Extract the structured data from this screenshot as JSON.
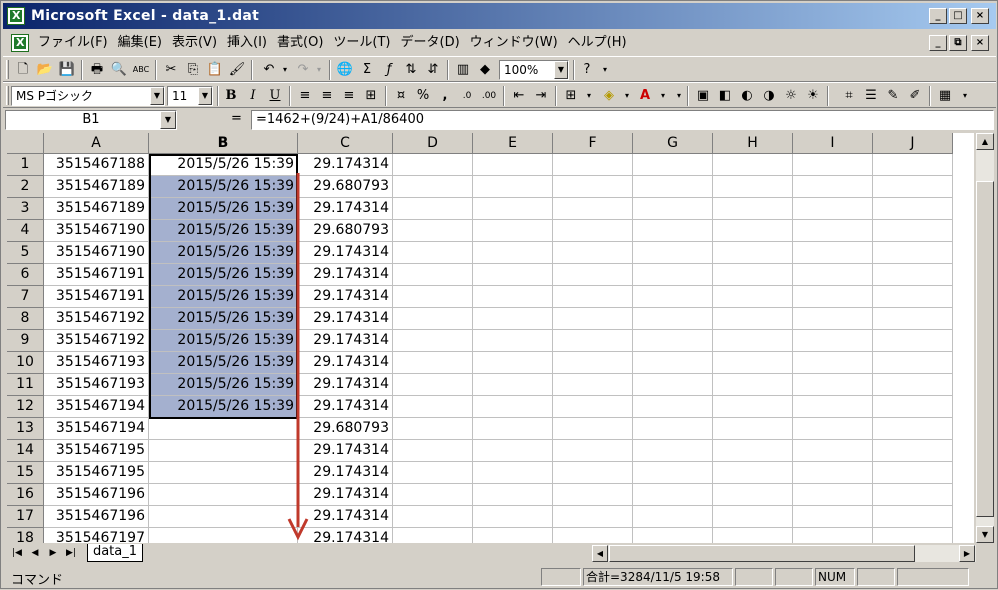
{
  "window": {
    "title": "Microsoft Excel - data_1.dat"
  },
  "title_buttons": {
    "minimize": "_",
    "restore": "□",
    "close": "×"
  },
  "doc_buttons": {
    "minimize": "_",
    "restore": "⧉",
    "close": "×"
  },
  "menu": [
    "ファイル(F)",
    "編集(E)",
    "表示(V)",
    "挿入(I)",
    "書式(O)",
    "ツール(T)",
    "データ(D)",
    "ウィンドウ(W)",
    "ヘルプ(H)"
  ],
  "toolbar": {
    "zoom": "100%"
  },
  "format_toolbar": {
    "font": "MS Pゴシック",
    "size": "11"
  },
  "formula_bar": {
    "name_box": "B1",
    "equals": "=",
    "formula": "=1462+(9/24)+A1/86400"
  },
  "columns": [
    "A",
    "B",
    "C",
    "D",
    "E",
    "F",
    "G",
    "H",
    "I",
    "J"
  ],
  "rows": [
    {
      "n": "1",
      "a": "3515467188",
      "b": "2015/5/26 15:39",
      "c": "29.174314"
    },
    {
      "n": "2",
      "a": "3515467189",
      "b": "2015/5/26 15:39",
      "c": "29.680793"
    },
    {
      "n": "3",
      "a": "3515467189",
      "b": "2015/5/26 15:39",
      "c": "29.174314"
    },
    {
      "n": "4",
      "a": "3515467190",
      "b": "2015/5/26 15:39",
      "c": "29.680793"
    },
    {
      "n": "5",
      "a": "3515467190",
      "b": "2015/5/26 15:39",
      "c": "29.174314"
    },
    {
      "n": "6",
      "a": "3515467191",
      "b": "2015/5/26 15:39",
      "c": "29.174314"
    },
    {
      "n": "7",
      "a": "3515467191",
      "b": "2015/5/26 15:39",
      "c": "29.174314"
    },
    {
      "n": "8",
      "a": "3515467192",
      "b": "2015/5/26 15:39",
      "c": "29.174314"
    },
    {
      "n": "9",
      "a": "3515467192",
      "b": "2015/5/26 15:39",
      "c": "29.174314"
    },
    {
      "n": "10",
      "a": "3515467193",
      "b": "2015/5/26 15:39",
      "c": "29.174314"
    },
    {
      "n": "11",
      "a": "3515467193",
      "b": "2015/5/26 15:39",
      "c": "29.174314"
    },
    {
      "n": "12",
      "a": "3515467194",
      "b": "2015/5/26 15:39",
      "c": "29.174314"
    },
    {
      "n": "13",
      "a": "3515467194",
      "b": "",
      "c": "29.680793"
    },
    {
      "n": "14",
      "a": "3515467195",
      "b": "",
      "c": "29.174314"
    },
    {
      "n": "15",
      "a": "3515467195",
      "b": "",
      "c": "29.174314"
    },
    {
      "n": "16",
      "a": "3515467196",
      "b": "",
      "c": "29.174314"
    },
    {
      "n": "17",
      "a": "3515467196",
      "b": "",
      "c": "29.174314"
    },
    {
      "n": "18",
      "a": "3515467197",
      "b": "",
      "c": "29.174314"
    }
  ],
  "sheet_tab": "data_1",
  "status": {
    "mode": "コマンド",
    "sum": "合計=3284/11/5 19:58",
    "num": "NUM"
  },
  "colors": {
    "titlebar_start": "#0a246a",
    "titlebar_end": "#a6caf0",
    "selection": "#a4b0cf",
    "arrow": "#c0392b"
  }
}
